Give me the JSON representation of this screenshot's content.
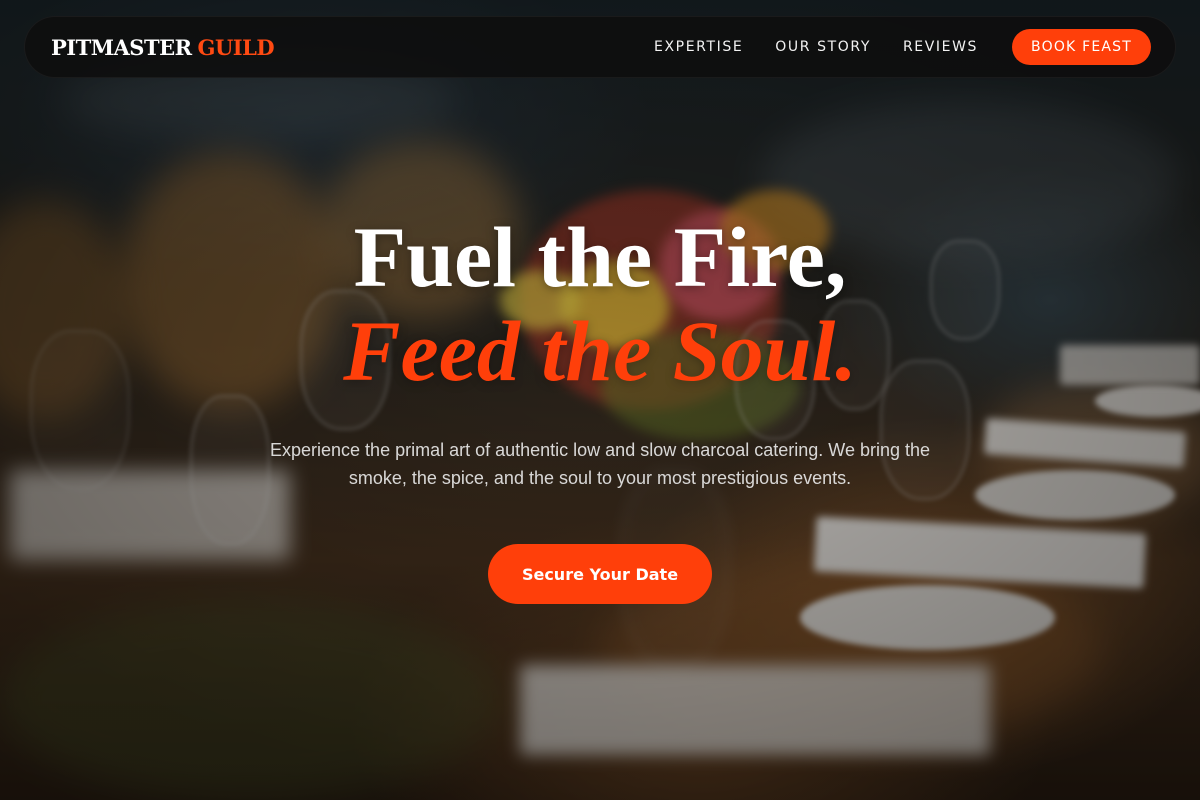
{
  "brand": {
    "name": "PITMASTER",
    "accent": "GUILD"
  },
  "nav": {
    "links": [
      "EXPERTISE",
      "OUR STORY",
      "REVIEWS"
    ],
    "cta_label": "BOOK FEAST"
  },
  "hero": {
    "headline_line1": "Fuel the Fire,",
    "headline_line2": "Feed the Soul.",
    "subtext": "Experience the primal art of authentic low and slow charcoal catering. We bring the smoke, the spice, and the soul to your most prestigious events.",
    "cta_label": "Secure Your Date"
  },
  "colors": {
    "accent": "#ff3f0a",
    "navbar_bg": "#0e0e0e",
    "text_primary": "#ffffff"
  }
}
